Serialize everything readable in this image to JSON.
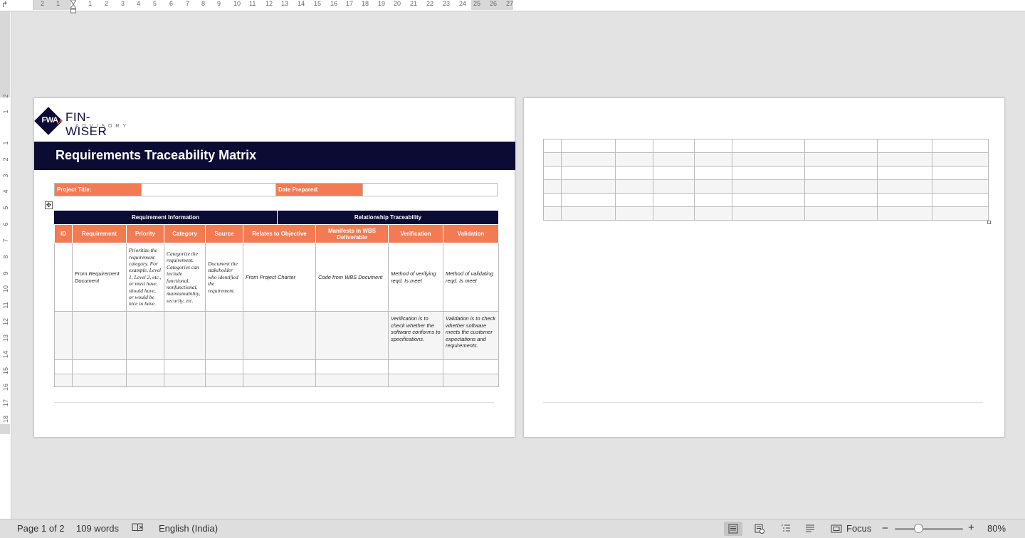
{
  "ruler": {
    "corner_glyph": "↱",
    "h_numbers": [
      "2",
      "1",
      "1",
      "2",
      "3",
      "4",
      "5",
      "6",
      "7",
      "8",
      "9",
      "10",
      "11",
      "12",
      "13",
      "14",
      "15",
      "16",
      "17",
      "18",
      "19",
      "20",
      "21",
      "22",
      "23",
      "24",
      "25",
      "26",
      "27"
    ],
    "v_numbers": [
      "2",
      "1",
      "1",
      "2",
      "3",
      "4",
      "5",
      "6",
      "7",
      "8",
      "9",
      "10",
      "11",
      "12",
      "13",
      "14",
      "15",
      "16",
      "17",
      "18"
    ]
  },
  "document": {
    "logo": {
      "monogram": "FWA",
      "brand": "FIN-WISER",
      "tagline": "ADVISORY"
    },
    "title": "Requirements Traceability Matrix",
    "project_title_label": "Project Title:",
    "project_title_value": "",
    "date_prepared_label": "Date Prepared:",
    "date_prepared_value": "",
    "table_move_glyph": "✥",
    "group_headers": [
      "Requirement Information",
      "Relationship Traceability"
    ],
    "columns": [
      "ID",
      "Requirement",
      "Priority",
      "Category",
      "Source",
      "Relates to Objective",
      "Manifests in WBS Deliverable",
      "Verification",
      "Validation"
    ],
    "rows": [
      {
        "id": "",
        "requirement": "From Requirement Document",
        "priority": "Prioritize the requirement category. For example, Level 1, Level 2, etc., or must have, should have, or would be nice to have.",
        "category": "Categorize the requirement. Categories can include functional, nonfunctional, maintainability, security, etc.",
        "source": "Document the stakeholder who identified the requirement.",
        "objective": "From Project Charter",
        "wbs": "Code from WBS Document",
        "verification": "Method of verifying reqd. Is meet",
        "validation": "Method of validating reqd. Is meet"
      },
      {
        "id": "",
        "requirement": "",
        "priority": "",
        "category": "",
        "source": "",
        "objective": "",
        "wbs": "",
        "verification": "Verification is to check whether the software conforms to specifications.",
        "validation": "Validation is to check whether software meets the customer expectations and requirements."
      }
    ]
  },
  "statusbar": {
    "page": "Page 1 of 2",
    "words": "109 words",
    "proofing_icon": "proofing-icon",
    "language": "English (India)",
    "focus_label": "Focus",
    "zoom_minus": "−",
    "zoom_plus": "+",
    "zoom": "80%",
    "zoom_fraction": 0.34
  },
  "colors": {
    "navy": "#0c0b34",
    "orange": "#f47a53",
    "canvas": "#e3e3e3"
  }
}
